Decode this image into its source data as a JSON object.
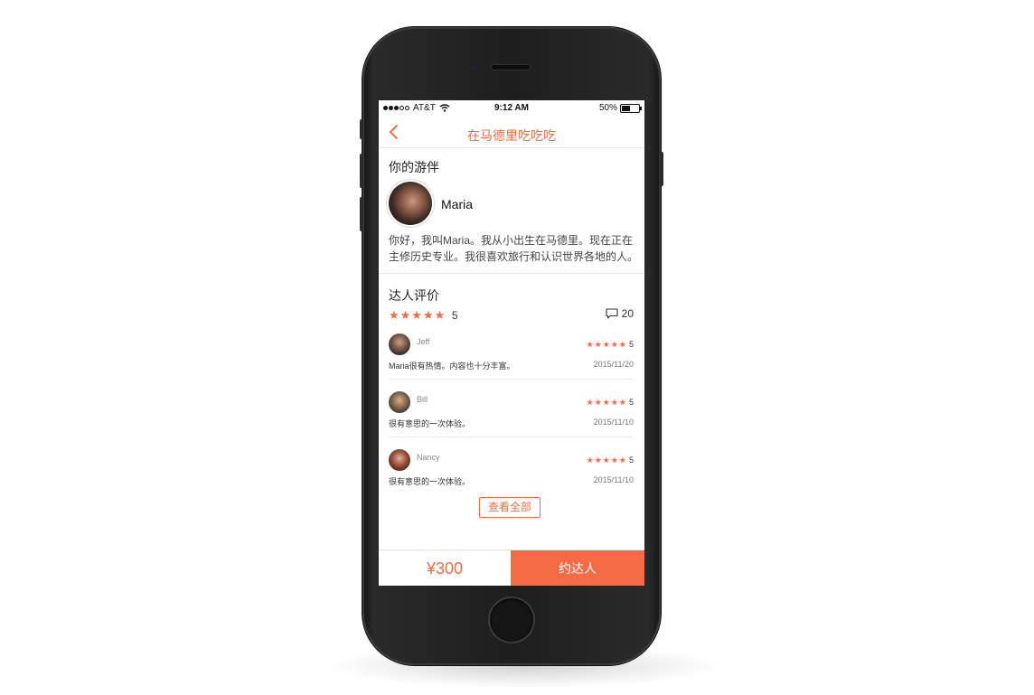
{
  "status_bar": {
    "carrier": "AT&T",
    "time": "9:12 AM",
    "battery": "50%",
    "battery_level": 0.5
  },
  "nav": {
    "title": "在马德里吃吃吃"
  },
  "guide": {
    "section_title": "你的游伴",
    "name": "Maria",
    "intro": "你好，我叫Maria。我从小出生在马德里。现在正在主修历史专业。我很喜欢旅行和认识世界各地的人。"
  },
  "reviews_section": {
    "title": "达人评价",
    "stars": "★★★★★",
    "rating": "5",
    "comment_count": "20"
  },
  "reviews": [
    {
      "name": "Jeff",
      "stars": "★★★★★",
      "score": "5",
      "text": "Maria很有热情。内容也十分丰富。",
      "date": "2015/11/20"
    },
    {
      "name": "Bill",
      "stars": "★★★★★",
      "score": "5",
      "text": "很有意思的一次体验。",
      "date": "2015/11/10"
    },
    {
      "name": "Nancy",
      "stars": "★★★★★",
      "score": "5",
      "text": "很有意思的一次体验。",
      "date": "2015/11/10"
    }
  ],
  "view_all_label": "查看全部",
  "bottom_bar": {
    "price": "¥300",
    "book_label": "约达人"
  },
  "colors": {
    "accent": "#f46b45"
  }
}
